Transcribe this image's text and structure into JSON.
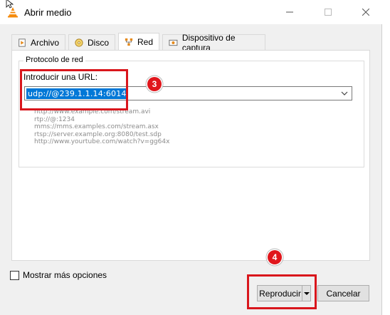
{
  "window": {
    "title": "Abrir medio",
    "minimize_icon": "minimize-icon",
    "maximize_icon": "maximize-icon",
    "close_icon": "close-icon"
  },
  "tabs": [
    {
      "label": "Archivo",
      "icon": "file-play-icon",
      "active": false
    },
    {
      "label": "Disco",
      "icon": "disc-icon",
      "active": false
    },
    {
      "label": "Red",
      "icon": "network-icon",
      "active": true
    },
    {
      "label": "Dispositivo de captura",
      "icon": "capture-device-icon",
      "active": false
    }
  ],
  "network": {
    "group_label": "Protocolo de red",
    "url_label": "Introducir una URL:",
    "url_value": "udp://@239.1.1.14:6014",
    "examples": [
      "http://www.example.com/stream.avi",
      "rtp://@:1234",
      "mms://mms.examples.com/stream.asx",
      "rtsp://server.example.org:8080/test.sdp",
      "http://www.yourtube.com/watch?v=gg64x"
    ]
  },
  "annotations": {
    "step3": "3",
    "step4": "4",
    "color": "#d9161c"
  },
  "footer": {
    "more_options_label": "Mostrar más opciones",
    "more_options_checked": false,
    "play_label": "Reproducir",
    "cancel_label": "Cancelar"
  }
}
